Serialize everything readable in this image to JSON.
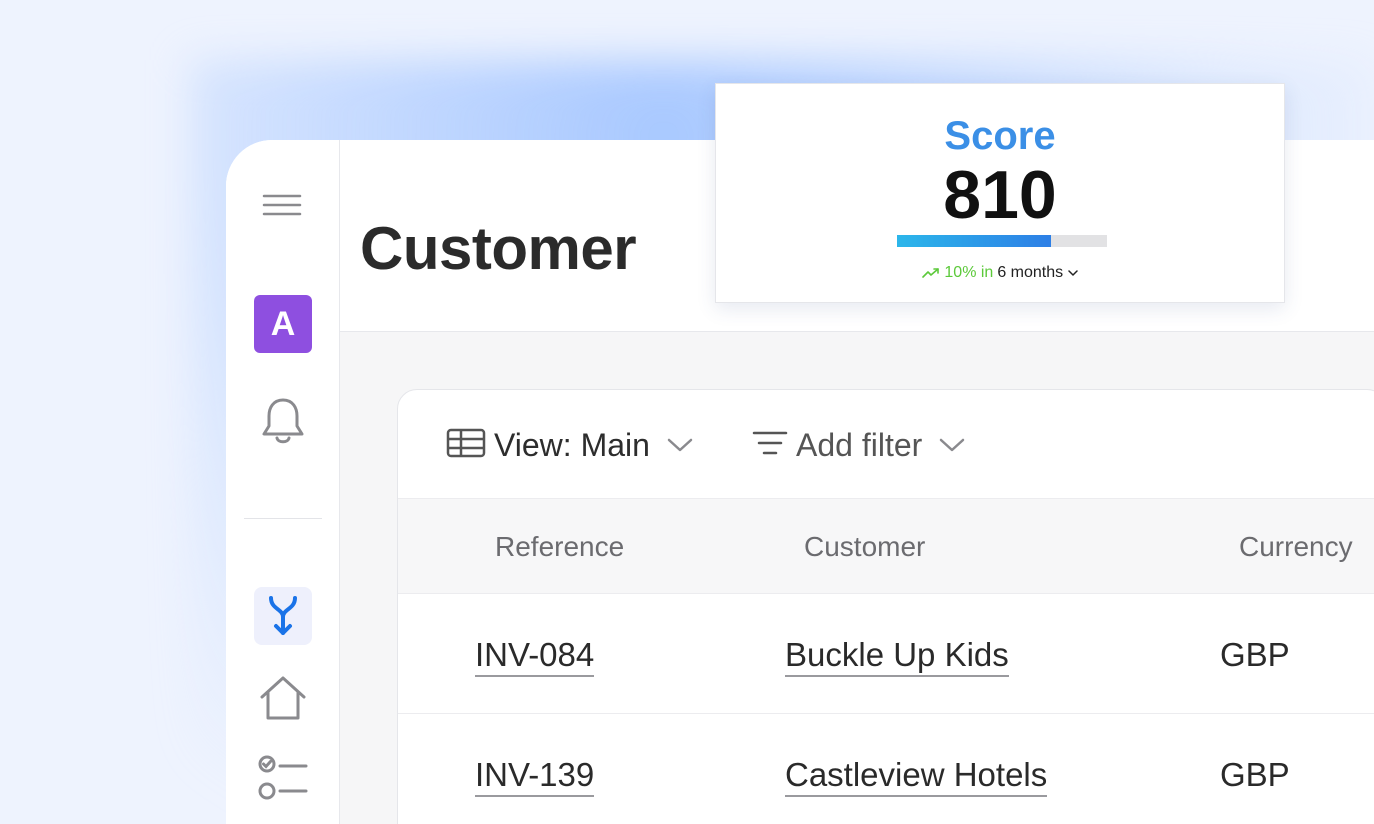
{
  "page": {
    "title": "Customer"
  },
  "sidebar": {
    "avatar_letter": "A"
  },
  "toolbar": {
    "view_label": "View: Main",
    "filter_label": "Add filter"
  },
  "table": {
    "columns": [
      "Reference",
      "Customer",
      "Currency"
    ],
    "rows": [
      {
        "reference": "INV-084",
        "customer": "Buckle Up Kids",
        "currency": "GBP"
      },
      {
        "reference": "INV-139",
        "customer": "Castleview Hotels",
        "currency": "GBP"
      }
    ]
  },
  "score": {
    "title": "Score",
    "value": "810",
    "progress_fraction": 0.735,
    "trend_value": "10% in",
    "trend_period": "6 months"
  },
  "colors": {
    "accent_purple": "#8e4fe0",
    "accent_blue": "#3b8fe6",
    "trend_green": "#5cc93a",
    "merge_icon_blue": "#1a73e8"
  }
}
